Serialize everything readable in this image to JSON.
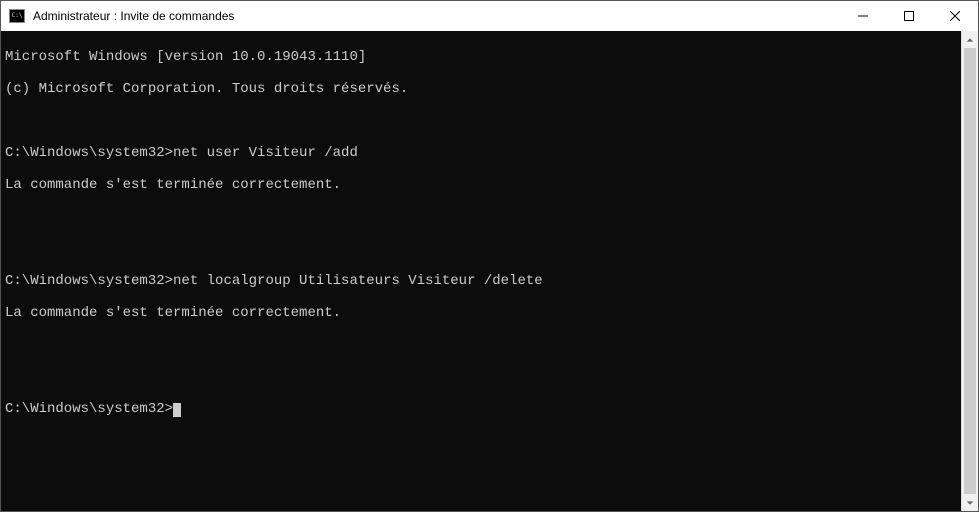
{
  "window": {
    "title": "Administrateur : Invite de commandes"
  },
  "terminal": {
    "header1": "Microsoft Windows [version 10.0.19043.1110]",
    "header2": "(c) Microsoft Corporation. Tous droits réservés.",
    "blank": "",
    "prompt1": "C:\\Windows\\system32>",
    "cmd1": "net user Visiteur /add",
    "out1": "La commande s'est terminée correctement.",
    "prompt2": "C:\\Windows\\system32>",
    "cmd2": "net localgroup Utilisateurs Visiteur /delete",
    "out2": "La commande s'est terminée correctement.",
    "prompt3": "C:\\Windows\\system32>"
  }
}
